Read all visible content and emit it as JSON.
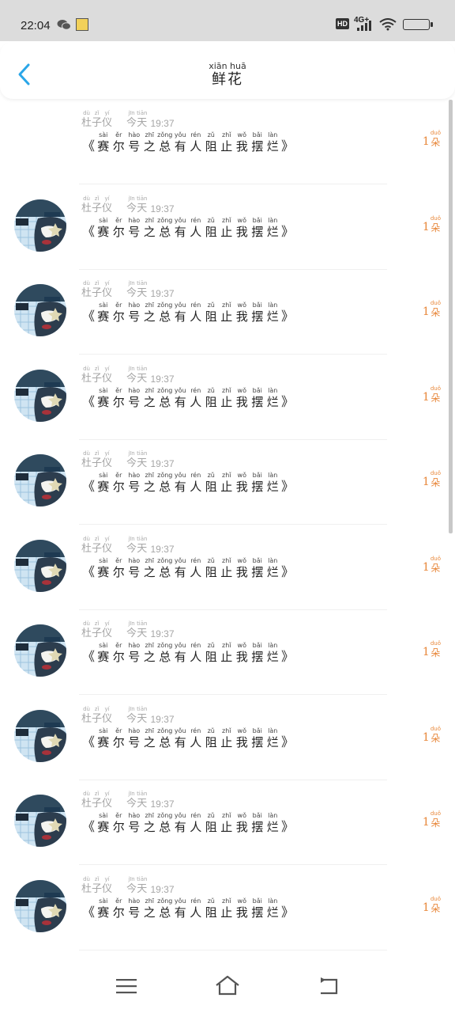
{
  "status_bar": {
    "time": "22:04",
    "hd": "HD",
    "network": "4G+"
  },
  "header": {
    "title_pinyin": "xiān huā",
    "title": "鲜花"
  },
  "items": [
    {
      "has_avatar": false,
      "name": [
        {
          "py": "dù",
          "hz": "杜"
        },
        {
          "py": "zǐ",
          "hz": "子"
        },
        {
          "py": "yí",
          "hz": "仪"
        }
      ],
      "day": [
        {
          "py": "jīn",
          "hz": "今"
        },
        {
          "py": "tiān",
          "hz": "天"
        }
      ],
      "time": "19:37",
      "book_open": "《",
      "book": [
        {
          "py": "sài",
          "hz": "赛"
        },
        {
          "py": "ěr",
          "hz": "尔"
        },
        {
          "py": "hào",
          "hz": "号"
        },
        {
          "py": "zhī",
          "hz": "之"
        },
        {
          "py": "zǒng",
          "hz": "总"
        },
        {
          "py": "yǒu",
          "hz": "有"
        },
        {
          "py": "rén",
          "hz": "人"
        },
        {
          "py": "zǔ",
          "hz": "阻"
        },
        {
          "py": "zhǐ",
          "hz": "止"
        },
        {
          "py": "wǒ",
          "hz": "我"
        },
        {
          "py": "bǎi",
          "hz": "摆"
        },
        {
          "py": "làn",
          "hz": "烂"
        }
      ],
      "book_close": "》",
      "count": "1",
      "unit": {
        "py": "duǒ",
        "hz": "朵"
      }
    },
    {
      "has_avatar": true,
      "name": [
        {
          "py": "dù",
          "hz": "杜"
        },
        {
          "py": "zǐ",
          "hz": "子"
        },
        {
          "py": "yí",
          "hz": "仪"
        }
      ],
      "day": [
        {
          "py": "jīn",
          "hz": "今"
        },
        {
          "py": "tiān",
          "hz": "天"
        }
      ],
      "time": "19:37",
      "book_open": "《",
      "book": [
        {
          "py": "sài",
          "hz": "赛"
        },
        {
          "py": "ěr",
          "hz": "尔"
        },
        {
          "py": "hào",
          "hz": "号"
        },
        {
          "py": "zhī",
          "hz": "之"
        },
        {
          "py": "zǒng",
          "hz": "总"
        },
        {
          "py": "yǒu",
          "hz": "有"
        },
        {
          "py": "rén",
          "hz": "人"
        },
        {
          "py": "zǔ",
          "hz": "阻"
        },
        {
          "py": "zhǐ",
          "hz": "止"
        },
        {
          "py": "wǒ",
          "hz": "我"
        },
        {
          "py": "bǎi",
          "hz": "摆"
        },
        {
          "py": "làn",
          "hz": "烂"
        }
      ],
      "book_close": "》",
      "count": "1",
      "unit": {
        "py": "duǒ",
        "hz": "朵"
      }
    },
    {
      "has_avatar": true,
      "name": [
        {
          "py": "dù",
          "hz": "杜"
        },
        {
          "py": "zǐ",
          "hz": "子"
        },
        {
          "py": "yí",
          "hz": "仪"
        }
      ],
      "day": [
        {
          "py": "jīn",
          "hz": "今"
        },
        {
          "py": "tiān",
          "hz": "天"
        }
      ],
      "time": "19:37",
      "book_open": "《",
      "book": [
        {
          "py": "sài",
          "hz": "赛"
        },
        {
          "py": "ěr",
          "hz": "尔"
        },
        {
          "py": "hào",
          "hz": "号"
        },
        {
          "py": "zhī",
          "hz": "之"
        },
        {
          "py": "zǒng",
          "hz": "总"
        },
        {
          "py": "yǒu",
          "hz": "有"
        },
        {
          "py": "rén",
          "hz": "人"
        },
        {
          "py": "zǔ",
          "hz": "阻"
        },
        {
          "py": "zhǐ",
          "hz": "止"
        },
        {
          "py": "wǒ",
          "hz": "我"
        },
        {
          "py": "bǎi",
          "hz": "摆"
        },
        {
          "py": "làn",
          "hz": "烂"
        }
      ],
      "book_close": "》",
      "count": "1",
      "unit": {
        "py": "duǒ",
        "hz": "朵"
      }
    },
    {
      "has_avatar": true,
      "name": [
        {
          "py": "dù",
          "hz": "杜"
        },
        {
          "py": "zǐ",
          "hz": "子"
        },
        {
          "py": "yí",
          "hz": "仪"
        }
      ],
      "day": [
        {
          "py": "jīn",
          "hz": "今"
        },
        {
          "py": "tiān",
          "hz": "天"
        }
      ],
      "time": "19:37",
      "book_open": "《",
      "book": [
        {
          "py": "sài",
          "hz": "赛"
        },
        {
          "py": "ěr",
          "hz": "尔"
        },
        {
          "py": "hào",
          "hz": "号"
        },
        {
          "py": "zhī",
          "hz": "之"
        },
        {
          "py": "zǒng",
          "hz": "总"
        },
        {
          "py": "yǒu",
          "hz": "有"
        },
        {
          "py": "rén",
          "hz": "人"
        },
        {
          "py": "zǔ",
          "hz": "阻"
        },
        {
          "py": "zhǐ",
          "hz": "止"
        },
        {
          "py": "wǒ",
          "hz": "我"
        },
        {
          "py": "bǎi",
          "hz": "摆"
        },
        {
          "py": "làn",
          "hz": "烂"
        }
      ],
      "book_close": "》",
      "count": "1",
      "unit": {
        "py": "duǒ",
        "hz": "朵"
      }
    },
    {
      "has_avatar": true,
      "name": [
        {
          "py": "dù",
          "hz": "杜"
        },
        {
          "py": "zǐ",
          "hz": "子"
        },
        {
          "py": "yí",
          "hz": "仪"
        }
      ],
      "day": [
        {
          "py": "jīn",
          "hz": "今"
        },
        {
          "py": "tiān",
          "hz": "天"
        }
      ],
      "time": "19:37",
      "book_open": "《",
      "book": [
        {
          "py": "sài",
          "hz": "赛"
        },
        {
          "py": "ěr",
          "hz": "尔"
        },
        {
          "py": "hào",
          "hz": "号"
        },
        {
          "py": "zhī",
          "hz": "之"
        },
        {
          "py": "zǒng",
          "hz": "总"
        },
        {
          "py": "yǒu",
          "hz": "有"
        },
        {
          "py": "rén",
          "hz": "人"
        },
        {
          "py": "zǔ",
          "hz": "阻"
        },
        {
          "py": "zhǐ",
          "hz": "止"
        },
        {
          "py": "wǒ",
          "hz": "我"
        },
        {
          "py": "bǎi",
          "hz": "摆"
        },
        {
          "py": "làn",
          "hz": "烂"
        }
      ],
      "book_close": "》",
      "count": "1",
      "unit": {
        "py": "duǒ",
        "hz": "朵"
      }
    },
    {
      "has_avatar": true,
      "name": [
        {
          "py": "dù",
          "hz": "杜"
        },
        {
          "py": "zǐ",
          "hz": "子"
        },
        {
          "py": "yí",
          "hz": "仪"
        }
      ],
      "day": [
        {
          "py": "jīn",
          "hz": "今"
        },
        {
          "py": "tiān",
          "hz": "天"
        }
      ],
      "time": "19:37",
      "book_open": "《",
      "book": [
        {
          "py": "sài",
          "hz": "赛"
        },
        {
          "py": "ěr",
          "hz": "尔"
        },
        {
          "py": "hào",
          "hz": "号"
        },
        {
          "py": "zhī",
          "hz": "之"
        },
        {
          "py": "zǒng",
          "hz": "总"
        },
        {
          "py": "yǒu",
          "hz": "有"
        },
        {
          "py": "rén",
          "hz": "人"
        },
        {
          "py": "zǔ",
          "hz": "阻"
        },
        {
          "py": "zhǐ",
          "hz": "止"
        },
        {
          "py": "wǒ",
          "hz": "我"
        },
        {
          "py": "bǎi",
          "hz": "摆"
        },
        {
          "py": "làn",
          "hz": "烂"
        }
      ],
      "book_close": "》",
      "count": "1",
      "unit": {
        "py": "duǒ",
        "hz": "朵"
      }
    },
    {
      "has_avatar": true,
      "name": [
        {
          "py": "dù",
          "hz": "杜"
        },
        {
          "py": "zǐ",
          "hz": "子"
        },
        {
          "py": "yí",
          "hz": "仪"
        }
      ],
      "day": [
        {
          "py": "jīn",
          "hz": "今"
        },
        {
          "py": "tiān",
          "hz": "天"
        }
      ],
      "time": "19:37",
      "book_open": "《",
      "book": [
        {
          "py": "sài",
          "hz": "赛"
        },
        {
          "py": "ěr",
          "hz": "尔"
        },
        {
          "py": "hào",
          "hz": "号"
        },
        {
          "py": "zhī",
          "hz": "之"
        },
        {
          "py": "zǒng",
          "hz": "总"
        },
        {
          "py": "yǒu",
          "hz": "有"
        },
        {
          "py": "rén",
          "hz": "人"
        },
        {
          "py": "zǔ",
          "hz": "阻"
        },
        {
          "py": "zhǐ",
          "hz": "止"
        },
        {
          "py": "wǒ",
          "hz": "我"
        },
        {
          "py": "bǎi",
          "hz": "摆"
        },
        {
          "py": "làn",
          "hz": "烂"
        }
      ],
      "book_close": "》",
      "count": "1",
      "unit": {
        "py": "duǒ",
        "hz": "朵"
      }
    },
    {
      "has_avatar": true,
      "name": [
        {
          "py": "dù",
          "hz": "杜"
        },
        {
          "py": "zǐ",
          "hz": "子"
        },
        {
          "py": "yí",
          "hz": "仪"
        }
      ],
      "day": [
        {
          "py": "jīn",
          "hz": "今"
        },
        {
          "py": "tiān",
          "hz": "天"
        }
      ],
      "time": "19:37",
      "book_open": "《",
      "book": [
        {
          "py": "sài",
          "hz": "赛"
        },
        {
          "py": "ěr",
          "hz": "尔"
        },
        {
          "py": "hào",
          "hz": "号"
        },
        {
          "py": "zhī",
          "hz": "之"
        },
        {
          "py": "zǒng",
          "hz": "总"
        },
        {
          "py": "yǒu",
          "hz": "有"
        },
        {
          "py": "rén",
          "hz": "人"
        },
        {
          "py": "zǔ",
          "hz": "阻"
        },
        {
          "py": "zhǐ",
          "hz": "止"
        },
        {
          "py": "wǒ",
          "hz": "我"
        },
        {
          "py": "bǎi",
          "hz": "摆"
        },
        {
          "py": "làn",
          "hz": "烂"
        }
      ],
      "book_close": "》",
      "count": "1",
      "unit": {
        "py": "duǒ",
        "hz": "朵"
      }
    },
    {
      "has_avatar": true,
      "name": [
        {
          "py": "dù",
          "hz": "杜"
        },
        {
          "py": "zǐ",
          "hz": "子"
        },
        {
          "py": "yí",
          "hz": "仪"
        }
      ],
      "day": [
        {
          "py": "jīn",
          "hz": "今"
        },
        {
          "py": "tiān",
          "hz": "天"
        }
      ],
      "time": "19:37",
      "book_open": "《",
      "book": [
        {
          "py": "sài",
          "hz": "赛"
        },
        {
          "py": "ěr",
          "hz": "尔"
        },
        {
          "py": "hào",
          "hz": "号"
        },
        {
          "py": "zhī",
          "hz": "之"
        },
        {
          "py": "zǒng",
          "hz": "总"
        },
        {
          "py": "yǒu",
          "hz": "有"
        },
        {
          "py": "rén",
          "hz": "人"
        },
        {
          "py": "zǔ",
          "hz": "阻"
        },
        {
          "py": "zhǐ",
          "hz": "止"
        },
        {
          "py": "wǒ",
          "hz": "我"
        },
        {
          "py": "bǎi",
          "hz": "摆"
        },
        {
          "py": "làn",
          "hz": "烂"
        }
      ],
      "book_close": "》",
      "count": "1",
      "unit": {
        "py": "duǒ",
        "hz": "朵"
      }
    },
    {
      "has_avatar": true,
      "name": [
        {
          "py": "dù",
          "hz": "杜"
        },
        {
          "py": "zǐ",
          "hz": "子"
        },
        {
          "py": "yí",
          "hz": "仪"
        }
      ],
      "day": [
        {
          "py": "jīn",
          "hz": "今"
        },
        {
          "py": "tiān",
          "hz": "天"
        }
      ],
      "time": "19:37",
      "book_open": "《",
      "book": [
        {
          "py": "sài",
          "hz": "赛"
        },
        {
          "py": "ěr",
          "hz": "尔"
        },
        {
          "py": "hào",
          "hz": "号"
        },
        {
          "py": "zhī",
          "hz": "之"
        },
        {
          "py": "zǒng",
          "hz": "总"
        },
        {
          "py": "yǒu",
          "hz": "有"
        },
        {
          "py": "rén",
          "hz": "人"
        },
        {
          "py": "zǔ",
          "hz": "阻"
        },
        {
          "py": "zhǐ",
          "hz": "止"
        },
        {
          "py": "wǒ",
          "hz": "我"
        },
        {
          "py": "bǎi",
          "hz": "摆"
        },
        {
          "py": "làn",
          "hz": "烂"
        }
      ],
      "book_close": "》",
      "count": "1",
      "unit": {
        "py": "duǒ",
        "hz": "朵"
      }
    }
  ],
  "nav": {
    "menu_icon": "menu-icon",
    "home_icon": "home-icon",
    "back_icon": "back-icon"
  },
  "colors": {
    "accent": "#2aa6e8",
    "gift": "#e8873a",
    "status_bar": "#dcdcdc"
  }
}
